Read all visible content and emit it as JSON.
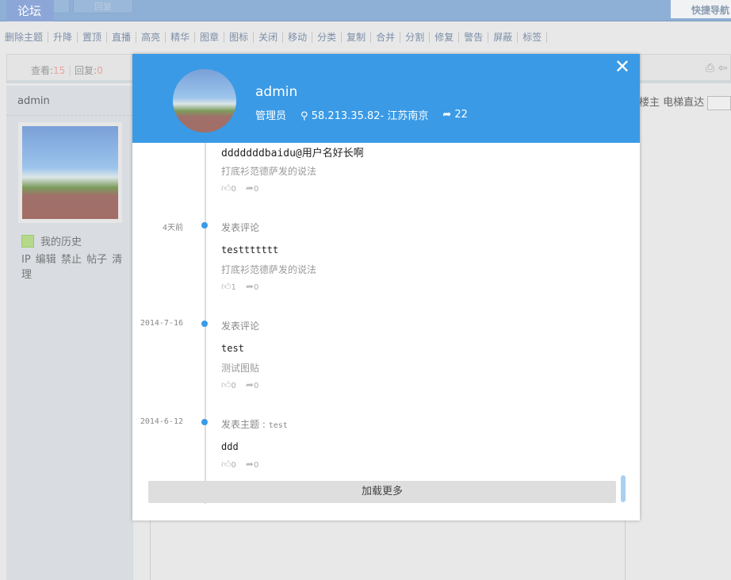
{
  "topbar": {
    "logo": "论坛",
    "btn1": "",
    "btn2": "回复",
    "quicknav": "快捷导航"
  },
  "toolbar": [
    "删除主题",
    "升降",
    "置顶",
    "直播",
    "高亮",
    "精华",
    "图章",
    "图标",
    "关闭",
    "移动",
    "分类",
    "复制",
    "合并",
    "分割",
    "修复",
    "警告",
    "屏蔽",
    "标签"
  ],
  "stats": {
    "views_label": "查看:",
    "views": "15",
    "replies_label": "回复:",
    "replies": "0"
  },
  "left": {
    "name": "admin",
    "history": "我的历史",
    "actions": "IP 编辑 禁止 帖子 清理"
  },
  "right": {
    "text": "楼主  电梯直达"
  },
  "modal": {
    "name": "admin",
    "role": "管理员",
    "location": "58.213.35.82- 江苏南京",
    "shares": "22",
    "entries": [
      {
        "date": "",
        "action": "",
        "title": "dddddddbaidu@用户名好长啊",
        "desc": "打底衫范德萨发的说法",
        "likes": "0",
        "shares": "0"
      },
      {
        "date": "4天前",
        "action": "发表评论",
        "title": "testtttttt",
        "desc": "打底衫范德萨发的说法",
        "likes": "1",
        "shares": "0"
      },
      {
        "date": "2014-7-16",
        "action": "发表评论",
        "title": "test",
        "desc": "测试图贴",
        "likes": "0",
        "shares": "0"
      },
      {
        "date": "2014-6-12",
        "action": "发表主题 : ",
        "action_topic": "test",
        "title": "ddd",
        "desc": "",
        "likes": "0",
        "shares": "0"
      }
    ],
    "load_more": "加载更多"
  },
  "colors": {
    "accent": "#3a9ae6",
    "topbar": "#8fb0d6"
  }
}
